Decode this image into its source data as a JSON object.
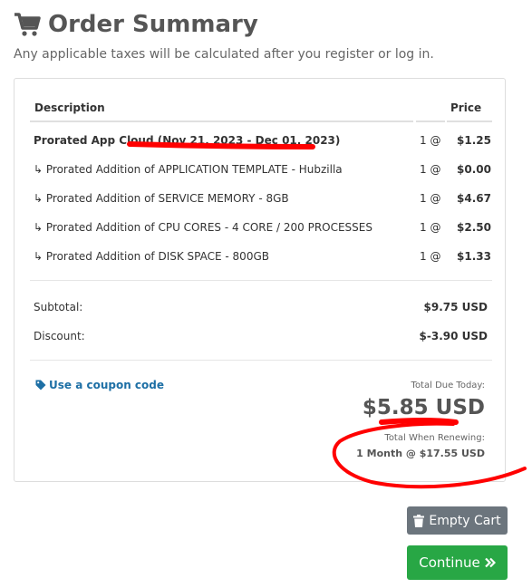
{
  "header": {
    "title": "Order Summary",
    "subtitle": "Any applicable taxes will be calculated after you register or log in."
  },
  "table": {
    "headers": {
      "description": "Description",
      "price": "Price"
    },
    "items": [
      {
        "description": "Prorated App Cloud (Nov 21, 2023 - Dec 01, 2023)",
        "qty": "1 @",
        "price": "$1.25",
        "bold": true
      },
      {
        "description": "↳ Prorated Addition of APPLICATION TEMPLATE - Hubzilla",
        "qty": "1 @",
        "price": "$0.00"
      },
      {
        "description": "↳ Prorated Addition of SERVICE MEMORY - 8GB",
        "qty": "1 @",
        "price": "$4.67"
      },
      {
        "description": "↳ Prorated Addition of CPU CORES - 4 CORE / 200 PROCESSES",
        "qty": "1 @",
        "price": "$2.50"
      },
      {
        "description": "↳ Prorated Addition of DISK SPACE - 800GB",
        "qty": "1 @",
        "price": "$1.33"
      }
    ]
  },
  "summary": {
    "subtotal_label": "Subtotal:",
    "subtotal_value": "$9.75 USD",
    "discount_label": "Discount:",
    "discount_value": "$-3.90 USD"
  },
  "coupon": {
    "label": "Use a coupon code",
    "icon": "tag-icon"
  },
  "totals": {
    "due_today_label": "Total Due Today:",
    "due_today_value": "$5.85 USD",
    "renewing_label": "Total When Renewing:",
    "renewing_value": "1 Month @ $17.55 USD"
  },
  "buttons": {
    "empty_cart": "Empty Cart",
    "continue": "Continue"
  },
  "colors": {
    "link": "#1d6fa5",
    "empty_cart_bg": "#6c757d",
    "continue_bg": "#28a745",
    "annotation": "#ff0000"
  }
}
